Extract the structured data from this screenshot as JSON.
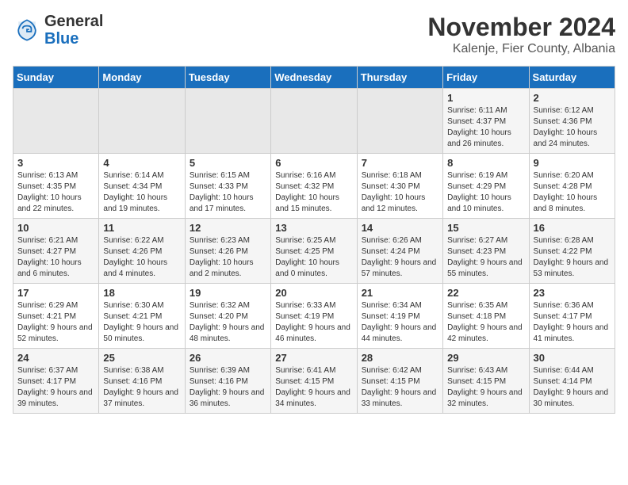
{
  "logo": {
    "text_general": "General",
    "text_blue": "Blue"
  },
  "title": "November 2024",
  "location": "Kalenje, Fier County, Albania",
  "headers": [
    "Sunday",
    "Monday",
    "Tuesday",
    "Wednesday",
    "Thursday",
    "Friday",
    "Saturday"
  ],
  "weeks": [
    [
      {
        "day": "",
        "sunrise": "",
        "sunset": "",
        "daylight": ""
      },
      {
        "day": "",
        "sunrise": "",
        "sunset": "",
        "daylight": ""
      },
      {
        "day": "",
        "sunrise": "",
        "sunset": "",
        "daylight": ""
      },
      {
        "day": "",
        "sunrise": "",
        "sunset": "",
        "daylight": ""
      },
      {
        "day": "",
        "sunrise": "",
        "sunset": "",
        "daylight": ""
      },
      {
        "day": "1",
        "sunrise": "Sunrise: 6:11 AM",
        "sunset": "Sunset: 4:37 PM",
        "daylight": "Daylight: 10 hours and 26 minutes."
      },
      {
        "day": "2",
        "sunrise": "Sunrise: 6:12 AM",
        "sunset": "Sunset: 4:36 PM",
        "daylight": "Daylight: 10 hours and 24 minutes."
      }
    ],
    [
      {
        "day": "3",
        "sunrise": "Sunrise: 6:13 AM",
        "sunset": "Sunset: 4:35 PM",
        "daylight": "Daylight: 10 hours and 22 minutes."
      },
      {
        "day": "4",
        "sunrise": "Sunrise: 6:14 AM",
        "sunset": "Sunset: 4:34 PM",
        "daylight": "Daylight: 10 hours and 19 minutes."
      },
      {
        "day": "5",
        "sunrise": "Sunrise: 6:15 AM",
        "sunset": "Sunset: 4:33 PM",
        "daylight": "Daylight: 10 hours and 17 minutes."
      },
      {
        "day": "6",
        "sunrise": "Sunrise: 6:16 AM",
        "sunset": "Sunset: 4:32 PM",
        "daylight": "Daylight: 10 hours and 15 minutes."
      },
      {
        "day": "7",
        "sunrise": "Sunrise: 6:18 AM",
        "sunset": "Sunset: 4:30 PM",
        "daylight": "Daylight: 10 hours and 12 minutes."
      },
      {
        "day": "8",
        "sunrise": "Sunrise: 6:19 AM",
        "sunset": "Sunset: 4:29 PM",
        "daylight": "Daylight: 10 hours and 10 minutes."
      },
      {
        "day": "9",
        "sunrise": "Sunrise: 6:20 AM",
        "sunset": "Sunset: 4:28 PM",
        "daylight": "Daylight: 10 hours and 8 minutes."
      }
    ],
    [
      {
        "day": "10",
        "sunrise": "Sunrise: 6:21 AM",
        "sunset": "Sunset: 4:27 PM",
        "daylight": "Daylight: 10 hours and 6 minutes."
      },
      {
        "day": "11",
        "sunrise": "Sunrise: 6:22 AM",
        "sunset": "Sunset: 4:26 PM",
        "daylight": "Daylight: 10 hours and 4 minutes."
      },
      {
        "day": "12",
        "sunrise": "Sunrise: 6:23 AM",
        "sunset": "Sunset: 4:26 PM",
        "daylight": "Daylight: 10 hours and 2 minutes."
      },
      {
        "day": "13",
        "sunrise": "Sunrise: 6:25 AM",
        "sunset": "Sunset: 4:25 PM",
        "daylight": "Daylight: 10 hours and 0 minutes."
      },
      {
        "day": "14",
        "sunrise": "Sunrise: 6:26 AM",
        "sunset": "Sunset: 4:24 PM",
        "daylight": "Daylight: 9 hours and 57 minutes."
      },
      {
        "day": "15",
        "sunrise": "Sunrise: 6:27 AM",
        "sunset": "Sunset: 4:23 PM",
        "daylight": "Daylight: 9 hours and 55 minutes."
      },
      {
        "day": "16",
        "sunrise": "Sunrise: 6:28 AM",
        "sunset": "Sunset: 4:22 PM",
        "daylight": "Daylight: 9 hours and 53 minutes."
      }
    ],
    [
      {
        "day": "17",
        "sunrise": "Sunrise: 6:29 AM",
        "sunset": "Sunset: 4:21 PM",
        "daylight": "Daylight: 9 hours and 52 minutes."
      },
      {
        "day": "18",
        "sunrise": "Sunrise: 6:30 AM",
        "sunset": "Sunset: 4:21 PM",
        "daylight": "Daylight: 9 hours and 50 minutes."
      },
      {
        "day": "19",
        "sunrise": "Sunrise: 6:32 AM",
        "sunset": "Sunset: 4:20 PM",
        "daylight": "Daylight: 9 hours and 48 minutes."
      },
      {
        "day": "20",
        "sunrise": "Sunrise: 6:33 AM",
        "sunset": "Sunset: 4:19 PM",
        "daylight": "Daylight: 9 hours and 46 minutes."
      },
      {
        "day": "21",
        "sunrise": "Sunrise: 6:34 AM",
        "sunset": "Sunset: 4:19 PM",
        "daylight": "Daylight: 9 hours and 44 minutes."
      },
      {
        "day": "22",
        "sunrise": "Sunrise: 6:35 AM",
        "sunset": "Sunset: 4:18 PM",
        "daylight": "Daylight: 9 hours and 42 minutes."
      },
      {
        "day": "23",
        "sunrise": "Sunrise: 6:36 AM",
        "sunset": "Sunset: 4:17 PM",
        "daylight": "Daylight: 9 hours and 41 minutes."
      }
    ],
    [
      {
        "day": "24",
        "sunrise": "Sunrise: 6:37 AM",
        "sunset": "Sunset: 4:17 PM",
        "daylight": "Daylight: 9 hours and 39 minutes."
      },
      {
        "day": "25",
        "sunrise": "Sunrise: 6:38 AM",
        "sunset": "Sunset: 4:16 PM",
        "daylight": "Daylight: 9 hours and 37 minutes."
      },
      {
        "day": "26",
        "sunrise": "Sunrise: 6:39 AM",
        "sunset": "Sunset: 4:16 PM",
        "daylight": "Daylight: 9 hours and 36 minutes."
      },
      {
        "day": "27",
        "sunrise": "Sunrise: 6:41 AM",
        "sunset": "Sunset: 4:15 PM",
        "daylight": "Daylight: 9 hours and 34 minutes."
      },
      {
        "day": "28",
        "sunrise": "Sunrise: 6:42 AM",
        "sunset": "Sunset: 4:15 PM",
        "daylight": "Daylight: 9 hours and 33 minutes."
      },
      {
        "day": "29",
        "sunrise": "Sunrise: 6:43 AM",
        "sunset": "Sunset: 4:15 PM",
        "daylight": "Daylight: 9 hours and 32 minutes."
      },
      {
        "day": "30",
        "sunrise": "Sunrise: 6:44 AM",
        "sunset": "Sunset: 4:14 PM",
        "daylight": "Daylight: 9 hours and 30 minutes."
      }
    ]
  ]
}
